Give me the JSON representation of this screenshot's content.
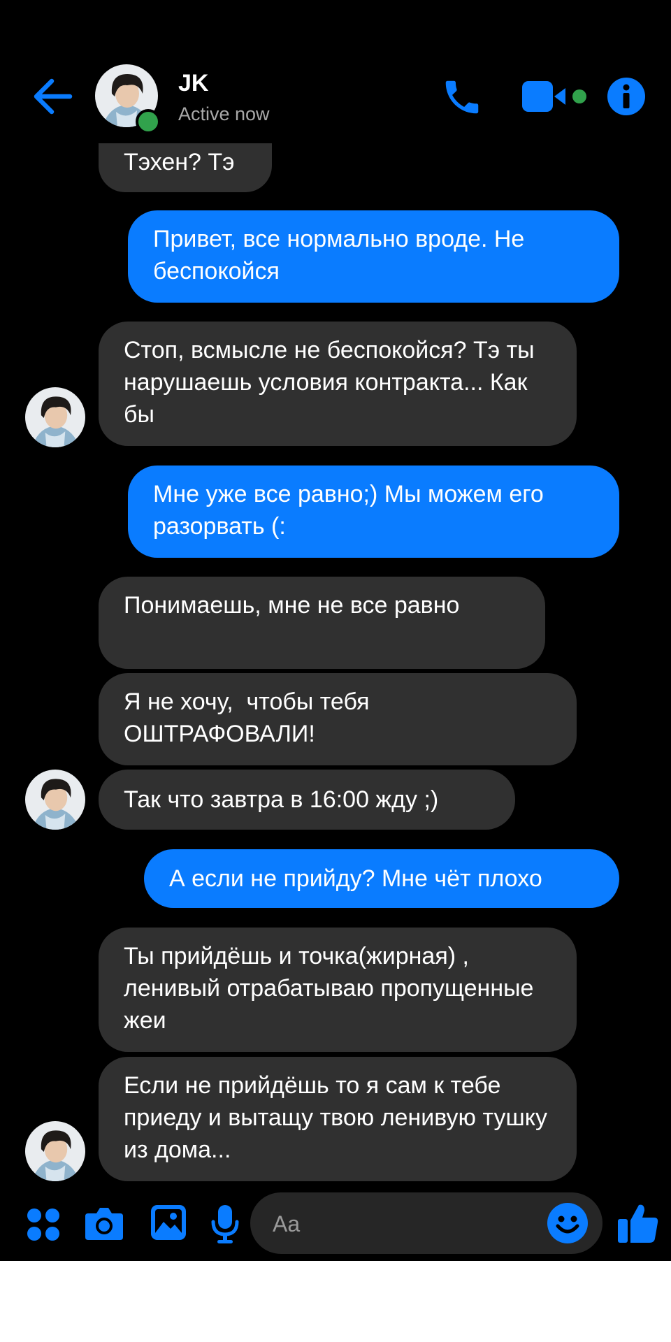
{
  "header": {
    "contact_name": "JK",
    "status": "Active now",
    "accent_color": "#0a7cff",
    "online_color": "#31a24c"
  },
  "messages": [
    {
      "sender": "contact",
      "text": "Тэхен? Тэ"
    },
    {
      "sender": "me",
      "text": "Привет, все нормально вроде. Не беспокойся"
    },
    {
      "sender": "contact",
      "text": "Стоп, всмысле не беспокойся? Тэ ты нарушаешь условия контракта... Как бы"
    },
    {
      "sender": "me",
      "text": "Мне уже все равно;) Мы можем его разорвать (:"
    },
    {
      "sender": "contact",
      "text": "Понимаешь, мне не все равно"
    },
    {
      "sender": "contact",
      "text": "Я не хочу,  чтобы тебя ОШТРАФОВАЛИ!"
    },
    {
      "sender": "contact",
      "text": "Так что завтра в 16:00 жду ;)"
    },
    {
      "sender": "me",
      "text": "А если не прийду? Мне чёт плохо"
    },
    {
      "sender": "contact",
      "text": "Ты прийдёшь и точка(жирная) , ленивый отрабатываю пропущенные жеи"
    },
    {
      "sender": "contact",
      "text": "Если не прийдёшь то я сам к тебе приеду и вытащу твою ленивую тушку из дома..."
    }
  ],
  "composer": {
    "placeholder": "Aa",
    "icons": [
      "apps-icon",
      "camera-icon",
      "gallery-icon",
      "microphone-icon",
      "emoji-icon",
      "like-icon"
    ]
  }
}
